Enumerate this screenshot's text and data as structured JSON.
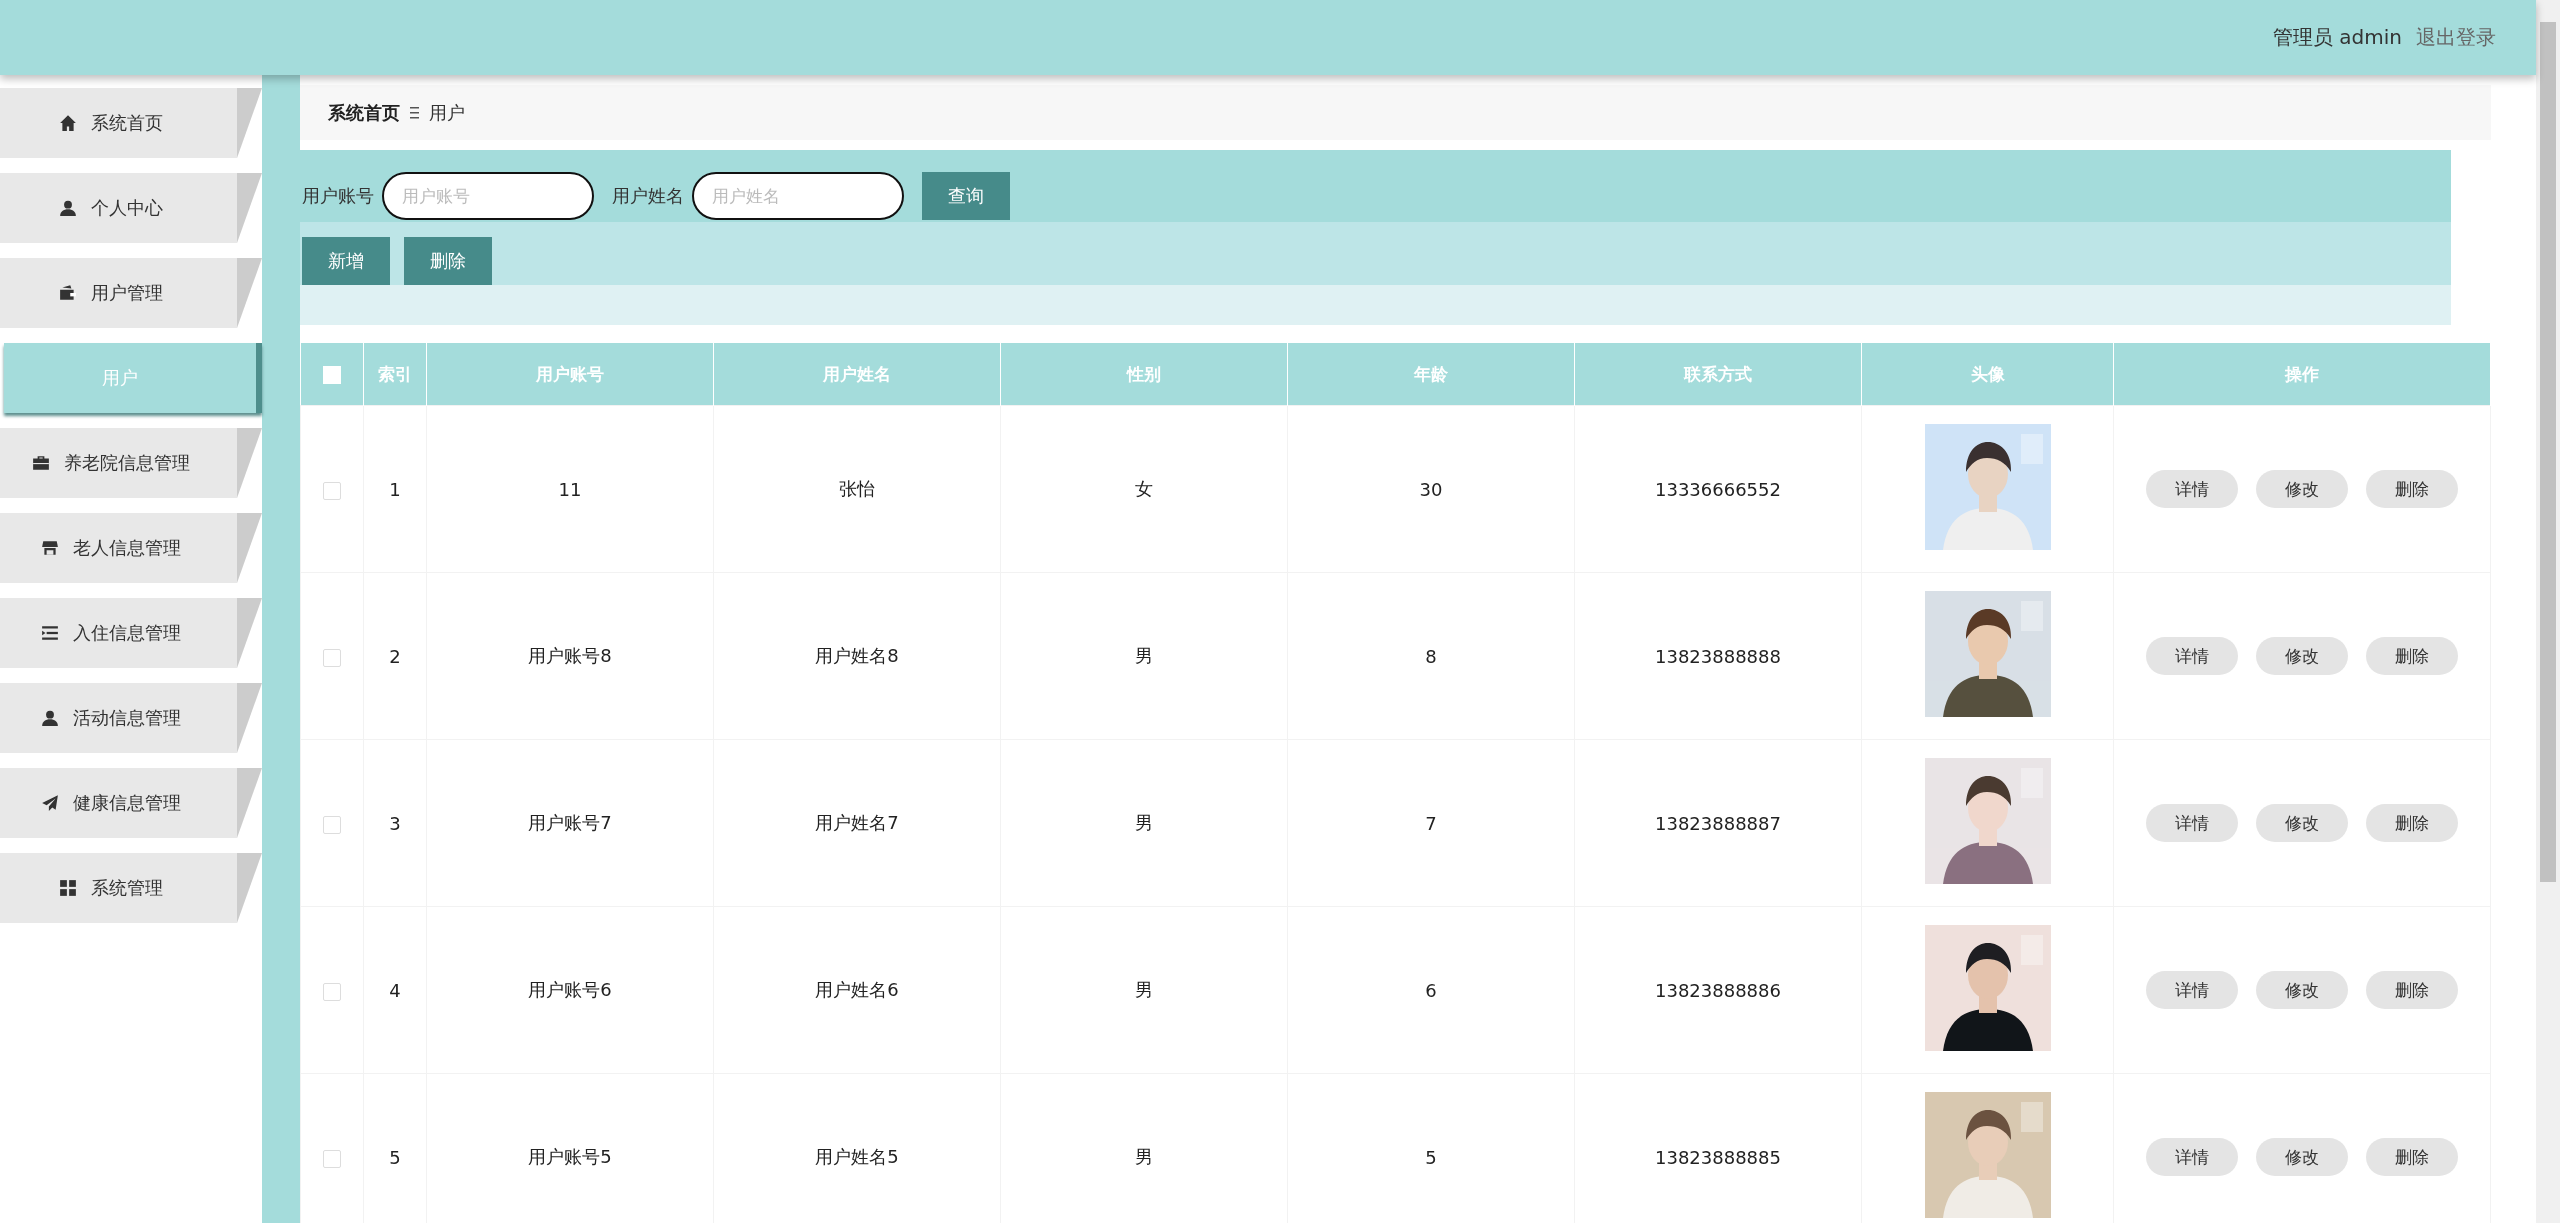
{
  "header": {
    "user": "管理员 admin",
    "logout": "退出登录"
  },
  "sidebar": {
    "items": [
      {
        "label": "系统首页",
        "selected": false
      },
      {
        "label": "个人中心",
        "selected": false
      },
      {
        "label": "用户管理",
        "selected": false,
        "children": [
          {
            "label": "用户",
            "selected": true
          }
        ]
      },
      {
        "label": "养老院信息管理",
        "selected": false
      },
      {
        "label": "老人信息管理",
        "selected": false
      },
      {
        "label": "入住信息管理",
        "selected": false
      },
      {
        "label": "活动信息管理",
        "selected": false
      },
      {
        "label": "健康信息管理",
        "selected": false
      },
      {
        "label": "系统管理",
        "selected": false
      }
    ]
  },
  "breadcrumb": [
    "系统首页",
    "用户"
  ],
  "search": {
    "fields": [
      {
        "label": "用户账号",
        "placeholder": "用户账号"
      },
      {
        "label": "用户姓名",
        "placeholder": "用户姓名"
      }
    ],
    "button": "查询"
  },
  "toolbar": [
    "新增",
    "删除"
  ],
  "table": {
    "select_all_checked": false,
    "columns": [
      "索引",
      "用户账号",
      "用户姓名",
      "性别",
      "年龄",
      "联系方式",
      "头像",
      "操作"
    ],
    "rows": [
      {
        "checked": false,
        "cells": [
          "1",
          "11",
          "张怡",
          "女",
          "30",
          "13336666552"
        ],
        "actions": [
          "详情",
          "修改",
          "删除"
        ]
      },
      {
        "checked": false,
        "cells": [
          "2",
          "用户账号8",
          "用户姓名8",
          "男",
          "8",
          "13823888888"
        ],
        "actions": [
          "详情",
          "修改",
          "删除"
        ]
      },
      {
        "checked": false,
        "cells": [
          "3",
          "用户账号7",
          "用户姓名7",
          "男",
          "7",
          "13823888887"
        ],
        "actions": [
          "详情",
          "修改",
          "删除"
        ]
      },
      {
        "checked": false,
        "cells": [
          "4",
          "用户账号6",
          "用户姓名6",
          "男",
          "6",
          "13823888886"
        ],
        "actions": [
          "详情",
          "修改",
          "删除"
        ]
      },
      {
        "checked": false,
        "cells": [
          "5",
          "用户账号5",
          "用户姓名5",
          "男",
          "5",
          "13823888885"
        ],
        "actions": [
          "详情",
          "修改",
          "删除"
        ]
      }
    ]
  }
}
